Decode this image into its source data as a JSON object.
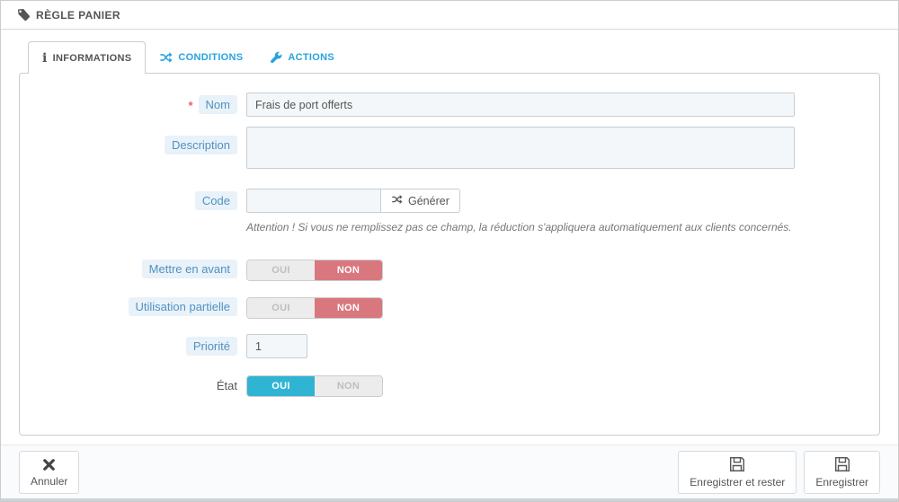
{
  "colors": {
    "accent_blue": "#27a3dc",
    "switch_on_blue": "#30b4d4",
    "switch_on_red": "#d9777f",
    "label_chip_bg": "#e9f2f9",
    "label_chip_text": "#5191c1"
  },
  "header": {
    "title": "RÈGLE PANIER"
  },
  "icons": {
    "info_glyph": "i"
  },
  "tabs": [
    {
      "label": "INFORMATIONS",
      "icon": "info-icon",
      "active": true
    },
    {
      "label": "CONDITIONS",
      "icon": "shuffle-icon",
      "active": false
    },
    {
      "label": "ACTIONS",
      "icon": "wrench-icon",
      "active": false
    }
  ],
  "form": {
    "name": {
      "label": "Nom",
      "required_mark": "*",
      "value": "Frais de port offerts"
    },
    "description": {
      "label": "Description",
      "value": ""
    },
    "code": {
      "label": "Code",
      "value": "",
      "generate_label": "Générer",
      "help": "Attention ! Si vous ne remplissez pas ce champ, la réduction s'appliquera automatiquement aux clients concernés."
    },
    "highlight": {
      "label": "Mettre en avant",
      "value": "NON",
      "options": [
        "OUI",
        "NON"
      ]
    },
    "partial_use": {
      "label": "Utilisation partielle",
      "value": "NON",
      "options": [
        "OUI",
        "NON"
      ]
    },
    "priority": {
      "label": "Priorité",
      "value": "1"
    },
    "status": {
      "label": "État",
      "value": "OUI",
      "options": [
        "OUI",
        "NON"
      ]
    }
  },
  "footer": {
    "cancel_label": "Annuler",
    "save_and_stay_label": "Enregistrer et rester",
    "save_label": "Enregistrer"
  }
}
